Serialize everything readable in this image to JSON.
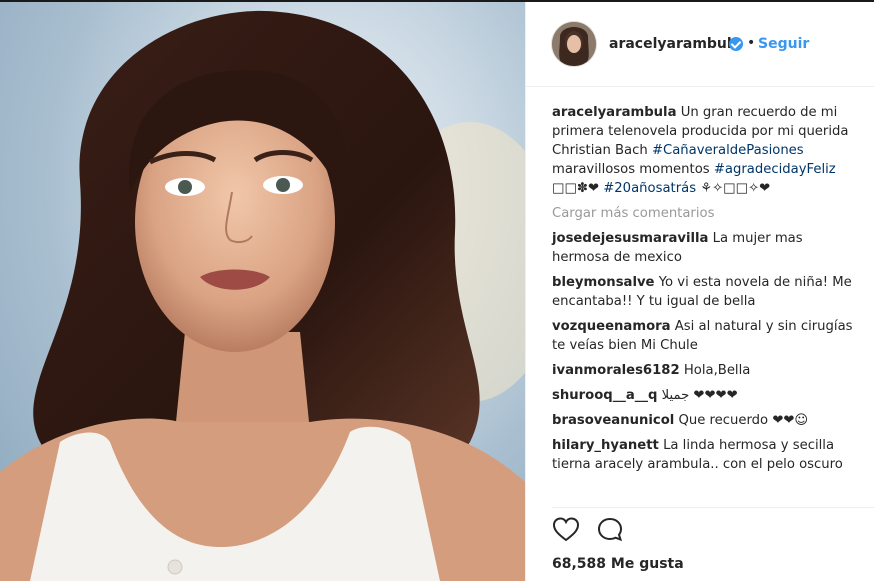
{
  "post": {
    "username": "aracelyarambula",
    "separator": "•",
    "follow_label": "Seguir",
    "caption": {
      "username": "aracelyarambula",
      "text_1": "Un gran recuerdo de mi primera telenovela producida por mi querida Christian Bach",
      "hashtag_1": "#CañaveraldePasiones",
      "text_2": "maravillosos momentos",
      "hashtag_2": "#agradecidayFeliz",
      "emoji_1": "□□✽❤",
      "hashtag_3": "#20añosatrás",
      "emoji_2": "⚘✧□□✧❤"
    },
    "load_more_label": "Cargar más comentarios",
    "comments": [
      {
        "user": "josedejesusmaravilla",
        "text": "La mujer mas hermosa de mexico"
      },
      {
        "user": "bleymonsalve",
        "text": "Yo vi esta novela de niña! Me encantaba!! Y tu igual de bella"
      },
      {
        "user": "vozqueenamora",
        "text": "Asi al natural y sin cirugías te veías bien Mi Chule"
      },
      {
        "user": "ivanmorales6182",
        "text": "Hola,Bella"
      },
      {
        "user": "shurooq__a__q",
        "text": "جميلا ❤❤❤❤"
      },
      {
        "user": "brasoveanunicol",
        "text": "Que recuerdo ❤❤☺"
      },
      {
        "user": "hilary_hyanett",
        "text": "La linda hermosa y secilla tierna aracely arambula.. con el pelo oscuro"
      }
    ],
    "likes_label": "68,588 Me gusta",
    "icons": {
      "verified": "verified-badge-icon",
      "like": "heart-icon",
      "comment": "comment-bubble-icon"
    },
    "colors": {
      "link_blue": "#3897f0",
      "hashtag": "#003569",
      "muted": "#999999"
    }
  }
}
